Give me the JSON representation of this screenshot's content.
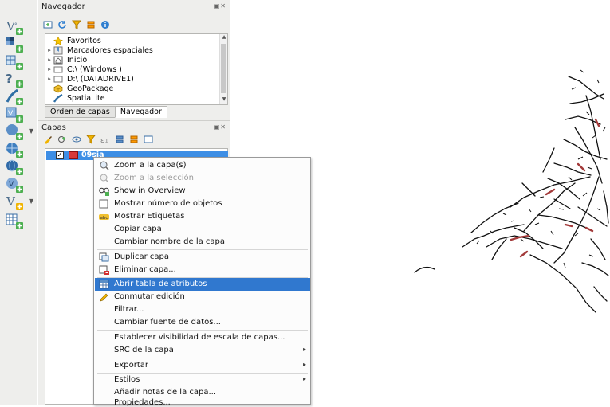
{
  "left_toolbar": {
    "icons": [
      "add-vector-layer-icon",
      "add-raster-layer-icon",
      "add-mesh-layer-icon",
      "add-delimited-text-icon",
      "add-spatialite-icon",
      "add-virtual-layer-icon",
      "add-wms-icon",
      "add-xyz-icon",
      "add-wcs-icon",
      "add-wfs-icon",
      "new-vector-layer-icon",
      "add-table-icon"
    ]
  },
  "browser_panel": {
    "title": "Navegador",
    "close_glyphs": "▣✕",
    "items": [
      {
        "label": "Favoritos",
        "icon": "star-icon",
        "expander": ""
      },
      {
        "label": "Marcadores espaciales",
        "icon": "bookmark-icon",
        "expander": "▸"
      },
      {
        "label": "Inicio",
        "icon": "home-folder-icon",
        "expander": "▸"
      },
      {
        "label": "C:\\ (Windows )",
        "icon": "drive-icon",
        "expander": "▸"
      },
      {
        "label": "D:\\ (DATADRIVE1)",
        "icon": "drive-icon",
        "expander": "▸"
      },
      {
        "label": "GeoPackage",
        "icon": "geopackage-icon",
        "expander": ""
      },
      {
        "label": "SpatiaLite",
        "icon": "spatialite-icon",
        "expander": ""
      }
    ]
  },
  "tabs": [
    "Orden de capas",
    "Navegador"
  ],
  "layers_panel": {
    "title": "Capas",
    "close_glyphs": "▣✕",
    "layer": {
      "name": "09sia",
      "checked": "✓",
      "color": "#d7393a"
    }
  },
  "context_menu": {
    "items": [
      {
        "label": "Zoom a la capa(s)",
        "icon": "zoom-layer-icon",
        "state": "normal"
      },
      {
        "label": "Zoom a la selección",
        "icon": "zoom-selection-icon",
        "state": "disabled"
      },
      {
        "label": "Show in Overview",
        "icon": "overview-icon",
        "state": "normal"
      },
      {
        "label": "Mostrar número de objetos",
        "icon": "checkbox-icon",
        "state": "normal"
      },
      {
        "label": "Mostrar Etiquetas",
        "icon": "labels-icon",
        "state": "normal"
      },
      {
        "label": "Copiar capa",
        "icon": "",
        "state": "normal"
      },
      {
        "label": "Cambiar nombre de la capa",
        "icon": "",
        "state": "normal"
      },
      {
        "label": "Duplicar capa",
        "icon": "duplicate-layer-icon",
        "state": "normal"
      },
      {
        "label": "Eliminar capa...",
        "icon": "remove-layer-icon",
        "state": "normal"
      },
      {
        "label": "Abrir tabla de atributos",
        "icon": "attribute-table-icon",
        "state": "highlight"
      },
      {
        "label": "Conmutar edición",
        "icon": "pencil-icon",
        "state": "normal"
      },
      {
        "label": "Filtrar...",
        "icon": "",
        "state": "normal"
      },
      {
        "label": "Cambiar fuente de datos...",
        "icon": "",
        "state": "normal"
      },
      {
        "label": "Establecer visibilidad de escala de capas...",
        "icon": "",
        "state": "normal"
      },
      {
        "label": "SRC de la capa",
        "icon": "",
        "state": "normal",
        "submenu": "▸"
      },
      {
        "label": "Exportar",
        "icon": "",
        "state": "normal",
        "submenu": "▸"
      },
      {
        "label": "Estilos",
        "icon": "",
        "state": "normal",
        "submenu": "▸"
      },
      {
        "label": "Añadir notas de la capa...",
        "icon": "",
        "state": "normal"
      },
      {
        "label": "Propiedades...",
        "icon": "",
        "state": "normal"
      }
    ]
  },
  "colors": {
    "selection": "#3d8ee5",
    "menu_highlight": "#3078cf",
    "layer_fill": "#d7393a",
    "feature_stroke": "#111111",
    "feature_accent": "#a33a3a"
  }
}
